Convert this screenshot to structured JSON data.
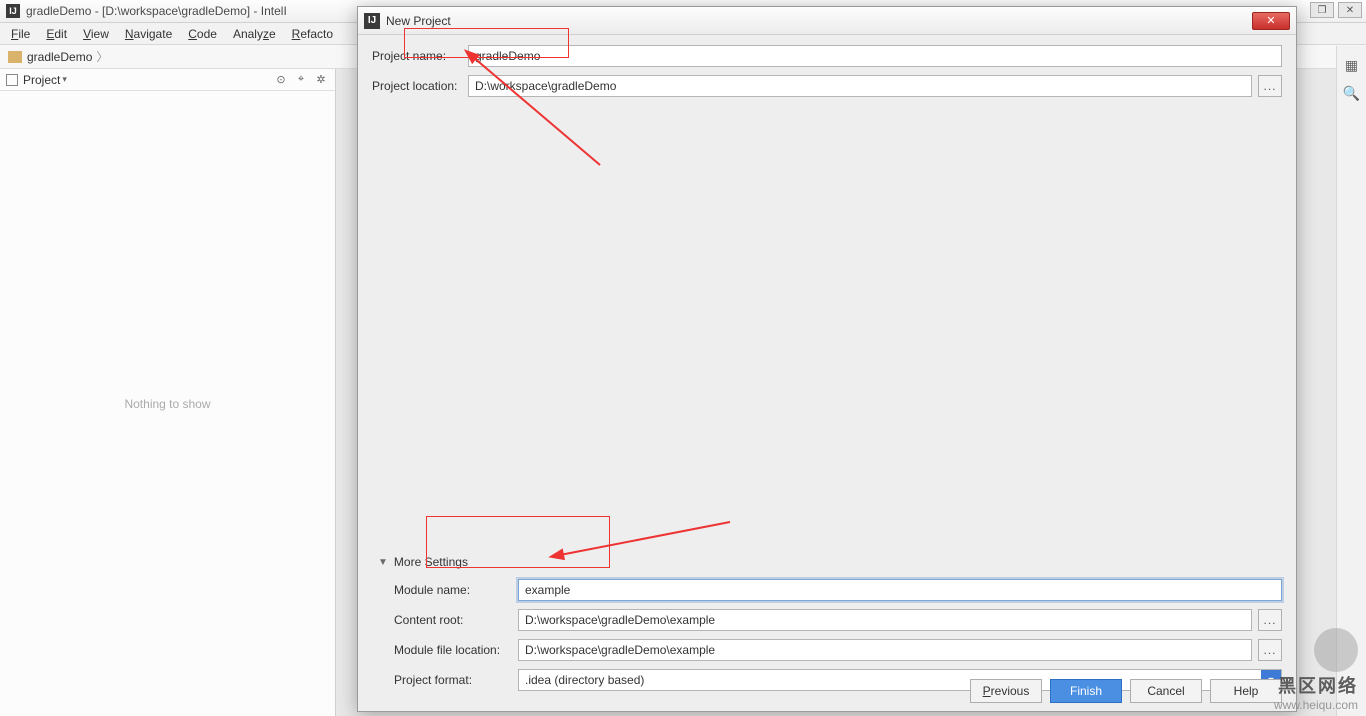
{
  "ide": {
    "title": "gradleDemo - [D:\\workspace\\gradleDemo] - IntelI",
    "menu": [
      "File",
      "Edit",
      "View",
      "Navigate",
      "Code",
      "Analyze",
      "Refacto"
    ],
    "breadcrumb": "gradleDemo",
    "project_panel_title": "Project",
    "empty_text": "Nothing to show"
  },
  "dialog": {
    "title": "New Project",
    "project_name_label": "Project name:",
    "project_name_value": "gradleDemo",
    "project_location_label": "Project location:",
    "project_location_value": "D:\\workspace\\gradleDemo",
    "more_settings_label": "More Settings",
    "module_name_label": "Module name:",
    "module_name_value": "example",
    "content_root_label": "Content root:",
    "content_root_value": "D:\\workspace\\gradleDemo\\example",
    "module_file_loc_label": "Module file location:",
    "module_file_loc_value": "D:\\workspace\\gradleDemo\\example",
    "project_format_label": "Project format:",
    "project_format_value": ".idea (directory based)",
    "buttons": {
      "previous": "Previous",
      "finish": "Finish",
      "cancel": "Cancel",
      "help": "Help"
    },
    "browse_label": "..."
  },
  "watermark": {
    "line1": "黑区网络",
    "line2": "www.heiqu.com"
  }
}
